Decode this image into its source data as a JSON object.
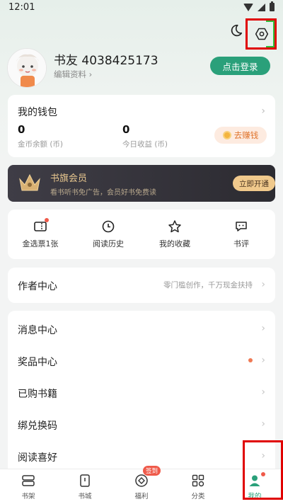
{
  "status_bar": {
    "time": "12:01"
  },
  "profile": {
    "username": "书友 4038425173",
    "edit_link": "编辑资料",
    "login_button": "点击登录"
  },
  "wallet": {
    "title": "我的钱包",
    "coins_value": "0",
    "coins_label": "金币余额 (币)",
    "today_value": "0",
    "today_label": "今日收益 (币)",
    "earn_button": "去赚钱"
  },
  "vip": {
    "title": "书旗会员",
    "subtitle": "看书听书免广告，会员好书免费读",
    "button": "立即开通"
  },
  "quick_actions": [
    {
      "label": "金选票1张",
      "icon": "ticket-icon"
    },
    {
      "label": "阅读历史",
      "icon": "clock-icon"
    },
    {
      "label": "我的收藏",
      "icon": "star-icon"
    },
    {
      "label": "书评",
      "icon": "comment-icon"
    }
  ],
  "author_center": {
    "title": "作者中心",
    "note": "零门槛创作，千万现金扶持"
  },
  "menu": [
    {
      "label": "消息中心"
    },
    {
      "label": "奖品中心"
    },
    {
      "label": "已购书籍"
    },
    {
      "label": "绑兑换码"
    },
    {
      "label": "阅读喜好"
    }
  ],
  "bottom_nav": [
    {
      "label": "书架",
      "icon": "bookshelf-icon"
    },
    {
      "label": "书城",
      "icon": "bookstore-icon"
    },
    {
      "label": "福利",
      "icon": "welfare-icon",
      "badge": "签到"
    },
    {
      "label": "分类",
      "icon": "category-icon"
    },
    {
      "label": "我的",
      "icon": "profile-icon",
      "active": true
    }
  ],
  "colors": {
    "accent": "#2aa07a",
    "vip_gold": "#e8c78f",
    "highlight_box": "#e00000"
  }
}
